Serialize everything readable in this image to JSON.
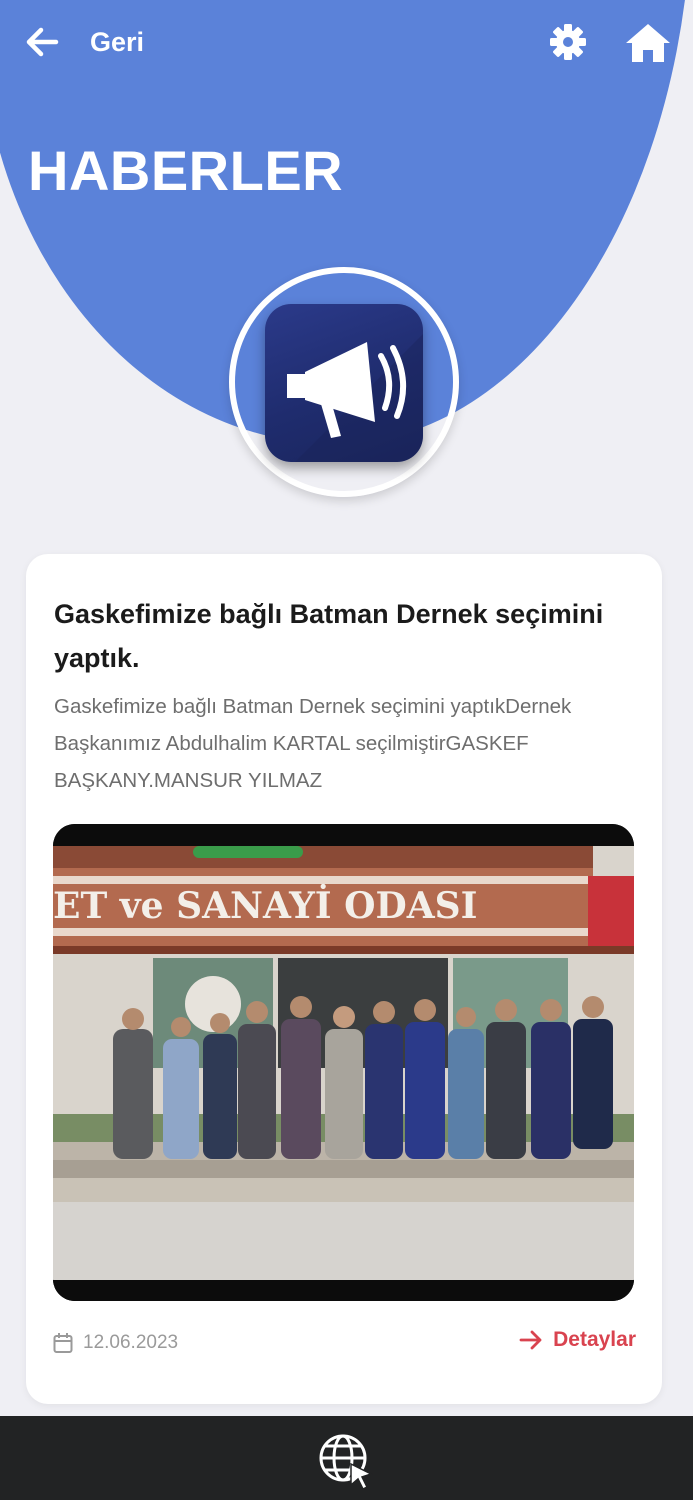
{
  "header": {
    "back_label": "Geri",
    "title": "HABERLER"
  },
  "icons": {
    "back": "arrow-left-icon",
    "settings": "gear-icon",
    "home": "home-icon",
    "badge": "megaphone-icon",
    "date": "calendar-icon",
    "details": "arrow-right-icon",
    "footer": "globe-cursor-icon"
  },
  "news": [
    {
      "title": "Gaskefimize bağlı Batman Dernek seçimini yaptık.",
      "description": "Gaskefimize bağlı Batman Dernek seçimini yaptıkDernek Başkanımız Abdulhalim KARTAL seçilmiştirGASKEF BAŞKANY.MANSUR YILMAZ",
      "date": "12.06.2023",
      "details_label": "Detaylar",
      "photo_sign": "ET ve SANAYİ ODASI"
    }
  ],
  "colors": {
    "accent": "#5b82d9",
    "badge": "#23307a",
    "link": "#d9434f",
    "footer": "#222324",
    "background": "#efeff4"
  }
}
